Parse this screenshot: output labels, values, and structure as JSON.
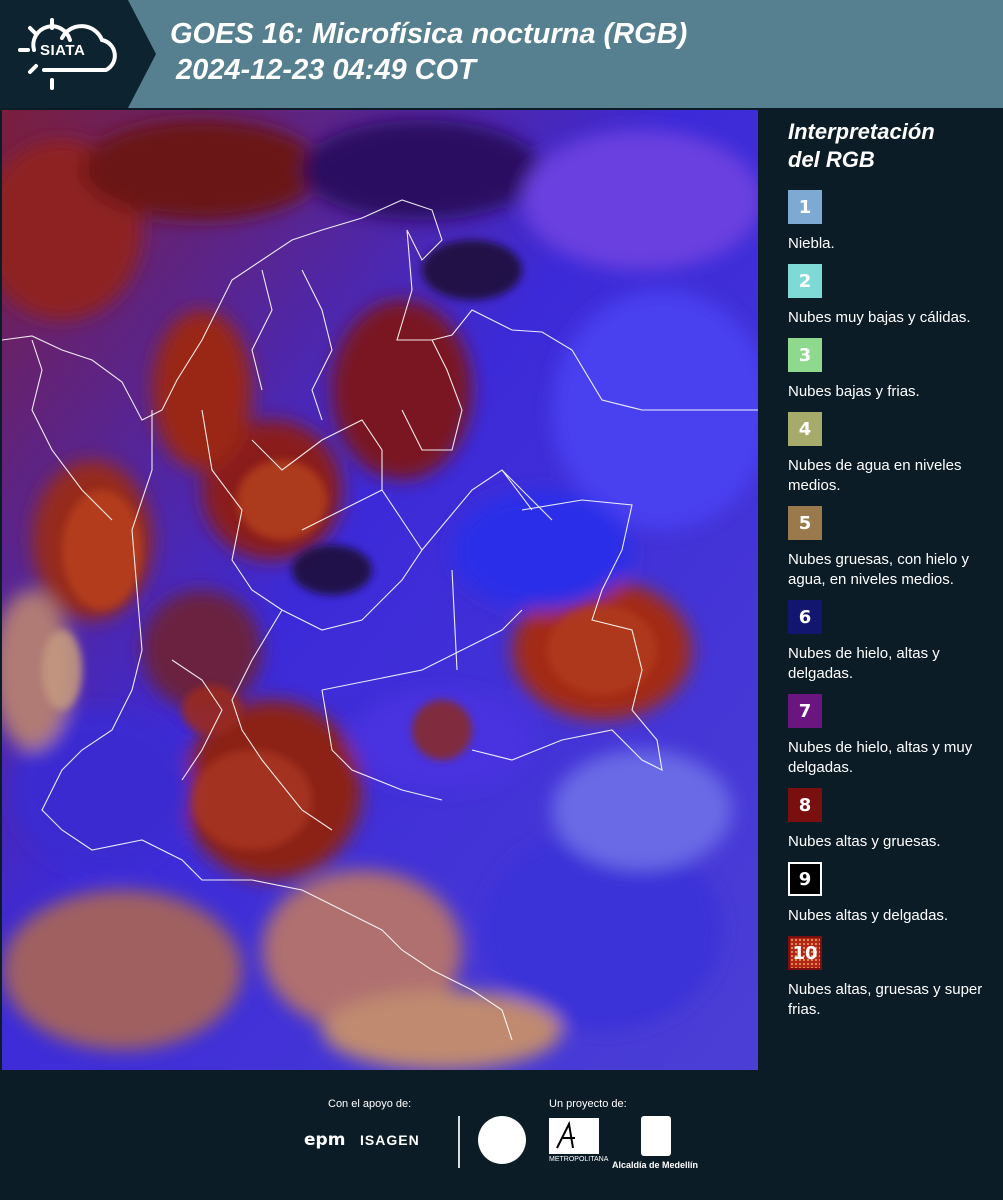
{
  "header": {
    "logo_text": "SIATA",
    "title_line1": "GOES 16: Microfísica nocturna (RGB)",
    "title_line2": "2024-12-23 04:49 COT"
  },
  "legend": {
    "title_line1": "Interpretación",
    "title_line2": "del RGB",
    "items": [
      {
        "number": "1",
        "color": "#7ea9d3",
        "label": "Niebla."
      },
      {
        "number": "2",
        "color": "#7fd9d5",
        "label": "Nubes muy bajas y cálidas."
      },
      {
        "number": "3",
        "color": "#8ed98e",
        "label": "Nubes bajas y frias."
      },
      {
        "number": "4",
        "color": "#a6ab6c",
        "label": "Nubes de agua en niveles medios."
      },
      {
        "number": "5",
        "color": "#9a7a4c",
        "label": "Nubes gruesas, con hielo y agua, en niveles medios."
      },
      {
        "number": "6",
        "color": "#12166e",
        "label": "Nubes de hielo, altas y delgadas."
      },
      {
        "number": "7",
        "color": "#6a1580",
        "label": "Nubes de hielo, altas y muy delgadas."
      },
      {
        "number": "8",
        "color": "#7a0f0f",
        "label": "Nubes altas y gruesas."
      },
      {
        "number": "9",
        "color": "#000000",
        "label": "Nubes altas y delgadas."
      },
      {
        "number": "10",
        "color": "#b52418",
        "label": "Nubes altas, gruesas y super frias."
      }
    ]
  },
  "footer": {
    "support_label": "Con el apoyo de:",
    "project_label": "Un proyecto de:",
    "sponsor1": "epm",
    "sponsor2": "ISAGEN",
    "partner_area": "METROPOLITANA",
    "partner_alcaldia": "Alcaldía de Medellín"
  }
}
